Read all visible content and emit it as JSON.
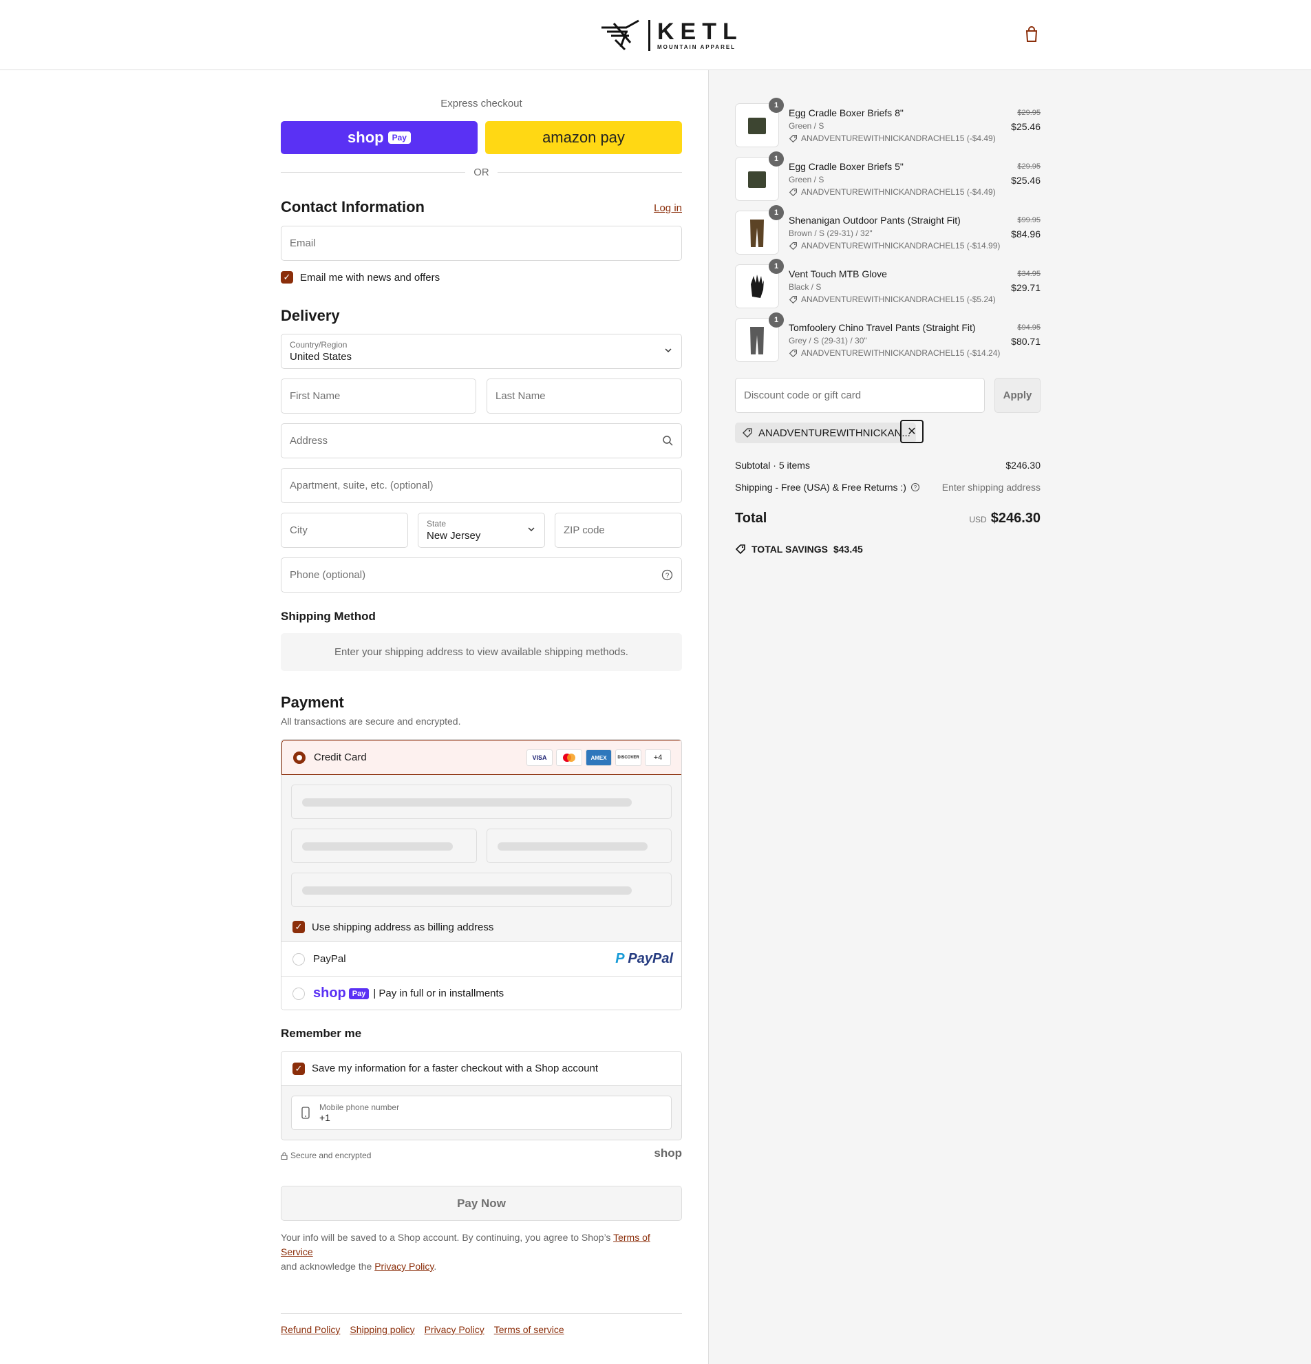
{
  "brand": {
    "name": "KETL",
    "tagline": "MOUNTAIN APPAREL"
  },
  "express": {
    "label": "Express checkout",
    "shop_pay": "shop",
    "shop_pay_badge": "Pay",
    "amazon_pay": "amazon pay",
    "or": "OR"
  },
  "contact": {
    "title": "Contact Information",
    "login": "Log in",
    "email_placeholder": "Email",
    "news_label": "Email me with news and offers"
  },
  "delivery": {
    "title": "Delivery",
    "country_label": "Country/Region",
    "country_value": "United States",
    "first_name": "First Name",
    "last_name": "Last Name",
    "address": "Address",
    "apartment": "Apartment, suite, etc. (optional)",
    "city": "City",
    "state_label": "State",
    "state_value": "New Jersey",
    "zip": "ZIP code",
    "phone": "Phone (optional)"
  },
  "shipping_method": {
    "title": "Shipping Method",
    "note": "Enter your shipping address to view available shipping methods."
  },
  "payment": {
    "title": "Payment",
    "subtitle": "All transactions are secure and encrypted.",
    "credit_card": "Credit Card",
    "cards": [
      "VISA",
      "MC",
      "AMEX",
      "DISCOVER",
      "+4"
    ],
    "billing_label": "Use shipping address as billing address",
    "paypal": "PayPal",
    "paypal_logo": "PayPal",
    "shoppay_word": "shop",
    "shoppay_badge": "Pay",
    "shoppay_text": "| Pay in full or in installments"
  },
  "remember": {
    "title": "Remember me",
    "save_label": "Save my information for a faster checkout with a Shop account",
    "mobile_label": "Mobile phone number",
    "mobile_value": "+1",
    "secure": "Secure and encrypted",
    "shop_logo": "shop"
  },
  "pay_now": "Pay Now",
  "terms": {
    "text1": "Your info will be saved to a Shop account. By continuing, you agree to Shop’s ",
    "tos": "Terms of Service",
    "text2": "and acknowledge the ",
    "privacy": "Privacy Policy",
    "text3": "."
  },
  "footer": [
    "Refund Policy",
    "Shipping policy",
    "Privacy Policy",
    "Terms of service"
  ],
  "order": {
    "items": [
      {
        "name": "Egg Cradle Boxer Briefs 8\"",
        "variant": "Green / S",
        "discount": "ANADVENTUREWITHNICKANDRACHEL15 (-$4.49)",
        "old": "$29.95",
        "price": "$25.46",
        "qty": "1",
        "color": "#3d4531"
      },
      {
        "name": "Egg Cradle Boxer Briefs 5\"",
        "variant": "Green / S",
        "discount": "ANADVENTUREWITHNICKANDRACHEL15 (-$4.49)",
        "old": "$29.95",
        "price": "$25.46",
        "qty": "1",
        "color": "#3d4531"
      },
      {
        "name": "Shenanigan Outdoor Pants (Straight Fit)",
        "variant": "Brown / S (29-31) / 32\"",
        "discount": "ANADVENTUREWITHNICKANDRACHEL15 (-$14.99)",
        "old": "$99.95",
        "price": "$84.96",
        "qty": "1",
        "color": "#5c4325"
      },
      {
        "name": "Vent Touch MTB Glove",
        "variant": "Black / S",
        "discount": "ANADVENTUREWITHNICKANDRACHEL15 (-$5.24)",
        "old": "$34.95",
        "price": "$29.71",
        "qty": "1",
        "color": "#1a1a1a"
      },
      {
        "name": "Tomfoolery Chino Travel Pants (Straight Fit)",
        "variant": "Grey / S (29-31) / 30\"",
        "discount": "ANADVENTUREWITHNICKANDRACHEL15 (-$14.24)",
        "old": "$94.95",
        "price": "$80.71",
        "qty": "1",
        "color": "#5a5a5a"
      }
    ],
    "discount_placeholder": "Discount code or gift card",
    "apply": "Apply",
    "applied_code": "ANADVENTUREWITHNICKAN...",
    "subtotal_label": "Subtotal · 5 items",
    "subtotal": "$246.30",
    "shipping_label": "Shipping - Free (USA) & Free Returns :)",
    "shipping_value": "Enter shipping address",
    "total_label": "Total",
    "currency": "USD",
    "total": "$246.30",
    "savings_label": "TOTAL SAVINGS",
    "savings": "$43.45"
  },
  "colors": {
    "accent": "#8b2e0a",
    "shoppay": "#5a31f4",
    "amazon": "#ffd814",
    "panel": "#f5f5f5"
  }
}
